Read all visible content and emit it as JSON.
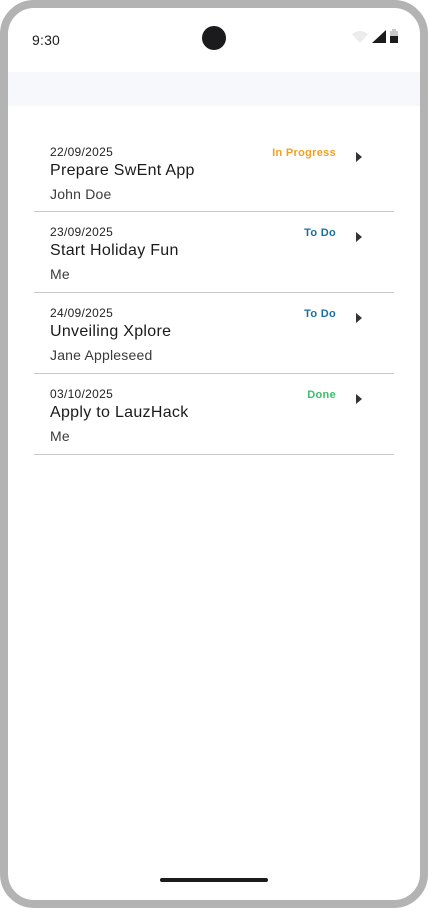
{
  "status_bar": {
    "time": "9:30",
    "icons": [
      "wifi-icon",
      "cellular-signal-icon",
      "battery-icon"
    ]
  },
  "colors": {
    "in_progress": "#f0a020",
    "todo": "#1a6fa0",
    "done": "#3bbf6a"
  },
  "todos": [
    {
      "date": "22/09/2025",
      "title": "Prepare SwEnt App",
      "assignee": "John Doe",
      "status": "In Progress"
    },
    {
      "date": "23/09/2025",
      "title": "Start Holiday Fun",
      "assignee": "Me",
      "status": "To Do"
    },
    {
      "date": "24/09/2025",
      "title": "Unveiling Xplore",
      "assignee": "Jane Appleseed",
      "status": "To Do"
    },
    {
      "date": "03/10/2025",
      "title": "Apply to LauzHack",
      "assignee": "Me",
      "status": "Done"
    }
  ]
}
